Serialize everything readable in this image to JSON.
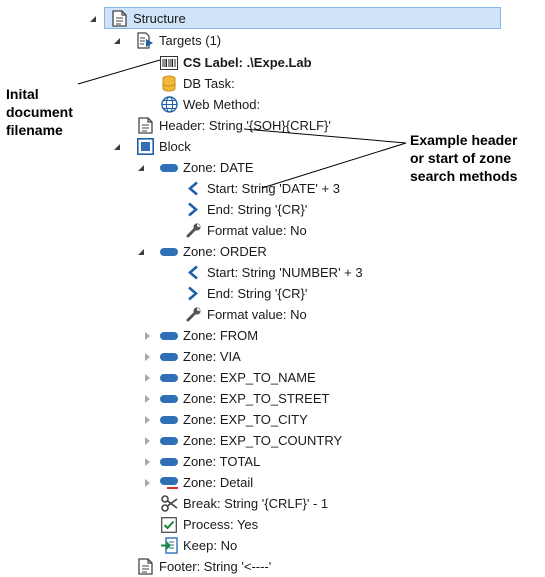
{
  "tree": {
    "root": "Structure",
    "targets": "Targets (1)",
    "cs_label": "CS Label: .\\Expe.Lab",
    "db_task": "DB Task:",
    "web_method": "Web Method:",
    "header": "Header: String '{SOH}{CRLF}'",
    "block": "Block",
    "zone_date": "Zone: DATE",
    "zone_date_start": "Start: String 'DATE' + 3",
    "zone_date_end": "End: String '{CR}'",
    "zone_date_format": "Format value: No",
    "zone_order": "Zone: ORDER",
    "zone_order_start": "Start: String 'NUMBER' + 3",
    "zone_order_end": "End: String '{CR}'",
    "zone_order_format": "Format value: No",
    "zone_from": "Zone: FROM",
    "zone_via": "Zone: VIA",
    "zone_exp_to_name": "Zone: EXP_TO_NAME",
    "zone_exp_to_street": "Zone: EXP_TO_STREET",
    "zone_exp_to_city": "Zone: EXP_TO_CITY",
    "zone_exp_to_country": "Zone: EXP_TO_COUNTRY",
    "zone_total": "Zone: TOTAL",
    "zone_detail": "Zone: Detail",
    "break": "Break: String '{CRLF}' - 1",
    "process": "Process: Yes",
    "keep": "Keep: No",
    "footer": "Footer: String '<----'"
  },
  "annotations": {
    "left_line1": "Inital",
    "left_line2": "document",
    "left_line3": "filename",
    "right_line1": "Example header",
    "right_line2": "or start of zone",
    "right_line3": "search methods"
  },
  "colors": {
    "selection_bg": "#cfe4f8",
    "selection_border": "#86b6e3",
    "zone_blue": "#2f6fb6",
    "chevron_blue": "#1f5fa8"
  }
}
